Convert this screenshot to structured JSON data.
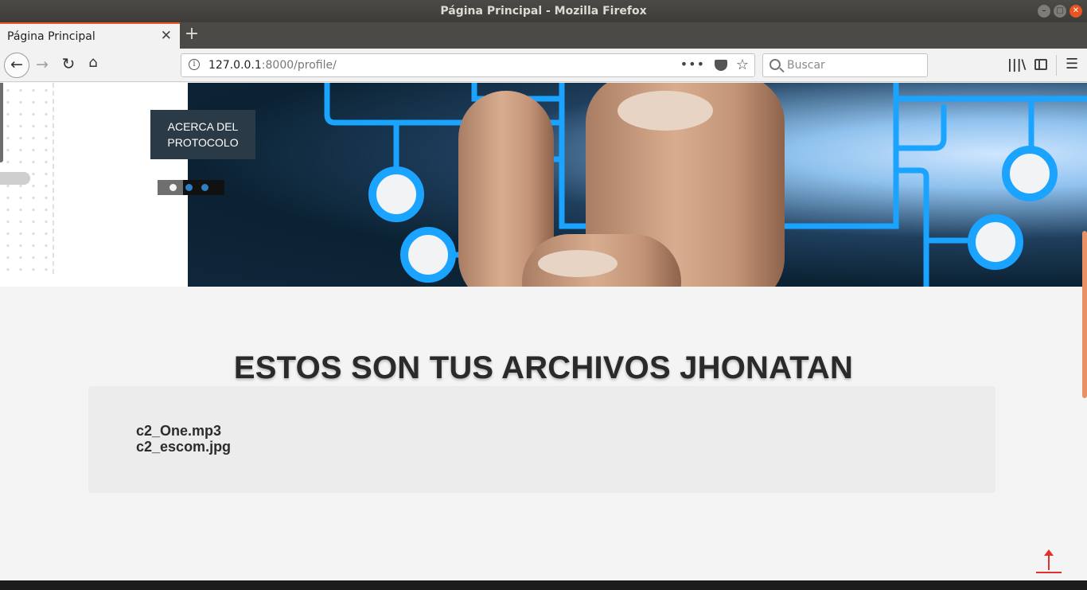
{
  "window": {
    "title": "Página Principal - Mozilla Firefox"
  },
  "tab": {
    "title": "Página Principal",
    "close": "✕",
    "new_tab": "+"
  },
  "nav": {
    "back": "←",
    "forward": "→",
    "reload": "↻",
    "home": "⌂"
  },
  "urlbar": {
    "host": "127.0.0.1",
    "rest": ":8000/profile/",
    "info": "i",
    "more": "•••",
    "bookmark": "☆"
  },
  "search": {
    "placeholder": "Buscar"
  },
  "toolbar": {
    "library": "|||\\",
    "menu": "☰"
  },
  "icons": {
    "window_controls": [
      "minimize-icon",
      "maximize-icon",
      "close-icon"
    ],
    "page": [
      "scroll-to-top-icon"
    ]
  },
  "colors": {
    "accent": "#e95420",
    "circuit": "#1aa3ff",
    "caption_bg": "#2b3a47",
    "scroll_top": "#e0312f"
  },
  "hero": {
    "caption_line1": "ACERCA DEL",
    "caption_line2": "PROTOCOLO",
    "slides_count": 3,
    "active_slide": 1
  },
  "section": {
    "title": "ESTOS SON TUS ARCHIVOS JHONATAN"
  },
  "files": [
    "c2_One.mp3",
    "c2_escom.jpg"
  ]
}
